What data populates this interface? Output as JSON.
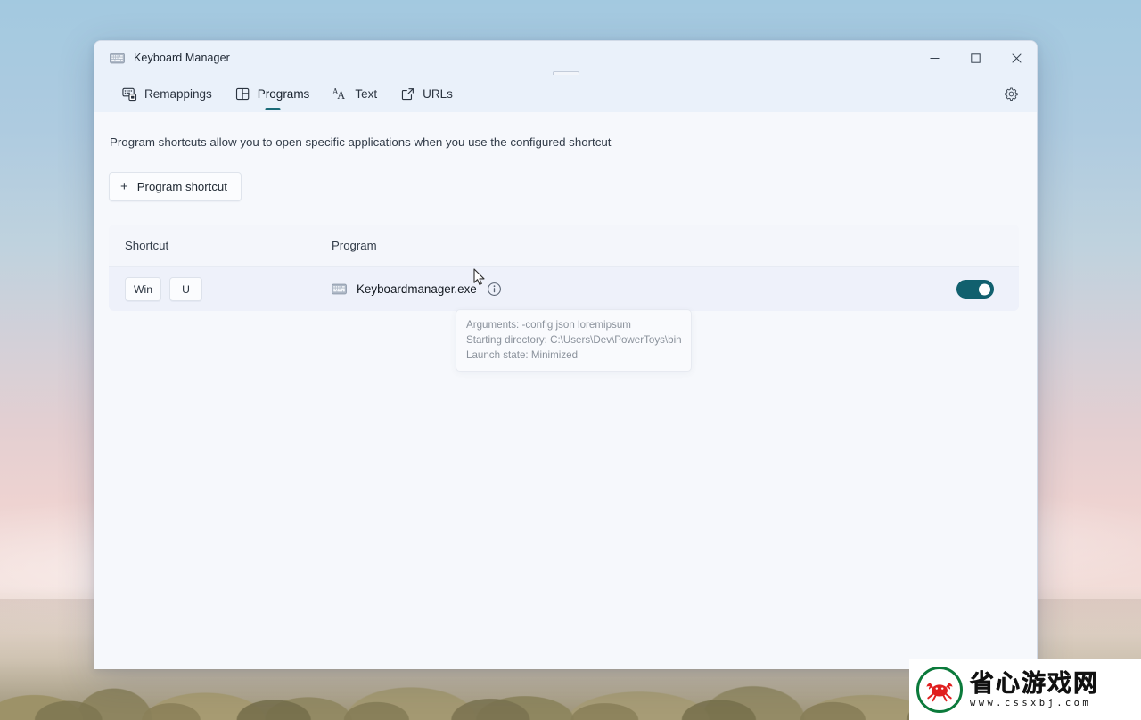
{
  "window": {
    "app_icon": "keyboard-icon",
    "title": "Keyboard Manager",
    "controls": {
      "minimize": "minimize-icon",
      "maximize": "maximize-icon",
      "close": "close-icon"
    }
  },
  "tabs": [
    {
      "label": "Remappings",
      "icon": "remappings-icon",
      "active": false
    },
    {
      "label": "Programs",
      "icon": "programs-grid-icon",
      "active": true
    },
    {
      "label": "Text",
      "icon": "text-aa-icon",
      "active": false
    },
    {
      "label": "URLs",
      "icon": "external-link-icon",
      "active": false
    }
  ],
  "settings_icon": "gear-icon",
  "main": {
    "description": "Program shortcuts allow you to open specific applications when you use the configured shortcut",
    "add_button": {
      "label": "Program shortcut",
      "icon": "plus-icon"
    },
    "table": {
      "headers": {
        "shortcut": "Shortcut",
        "program": "Program"
      },
      "rows": [
        {
          "keys": [
            "Win",
            "U"
          ],
          "program_icon": "keyboard-icon",
          "program": "Keyboardmanager.exe",
          "info_icon": "info-icon",
          "enabled": true
        }
      ]
    },
    "tooltip": {
      "line1": "Arguments: -config json loremipsum",
      "line2": "Starting directory: C:\\Users\\Dev\\PowerToys\\bin",
      "line3": "Launch state: Minimized"
    }
  },
  "colors": {
    "accent": "#11606e",
    "tab_indicator": "#1b6b78",
    "window_bg": "#f6f8fc",
    "titlebar_bg": "#eaf1fa",
    "row_bg": "#eef1fa"
  },
  "watermark": {
    "logo": "crab-logo-icon",
    "text": "省心游戏网",
    "url": "www.cssxbj.com"
  }
}
